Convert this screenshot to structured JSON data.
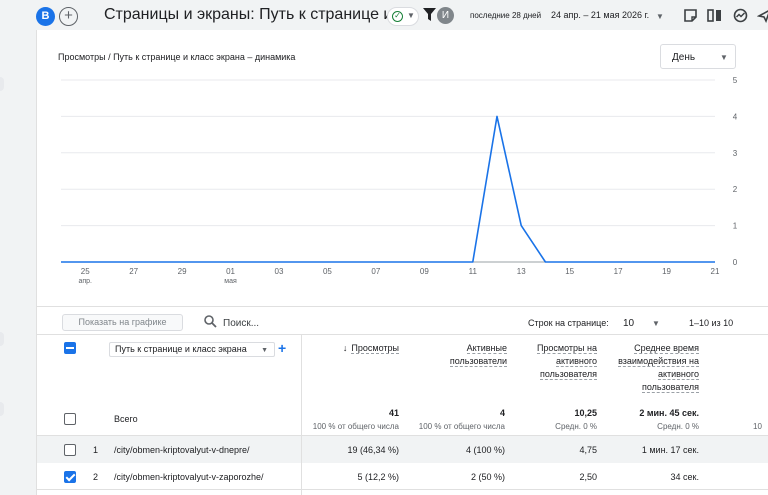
{
  "header": {
    "avatar_letter": "В",
    "add_label": "+",
    "title": "Страницы и экраны: Путь к странице и к...",
    "user_initial": "И",
    "daterange_label": "последние 28 дней",
    "daterange_value": "24 апр. – 21 мая 2026 г.",
    "icons": [
      "note-icon",
      "compare-icon",
      "insights-icon",
      "share-icon"
    ]
  },
  "chart": {
    "title": "Просмотры / Путь к странице и класс экрана – динамика",
    "granularity": "День"
  },
  "chart_data": {
    "type": "line",
    "x_ticks": [
      "25",
      "27",
      "29",
      "01",
      "03",
      "05",
      "07",
      "09",
      "11",
      "13",
      "15",
      "17",
      "19",
      "21"
    ],
    "x_subticks": {
      "25": "апр.",
      "01": "мая"
    },
    "x": [
      "24 апр.",
      "25 апр.",
      "26 апр.",
      "27 апр.",
      "28 апр.",
      "29 апр.",
      "30 апр.",
      "01 мая",
      "02 мая",
      "03 мая",
      "04 мая",
      "05 мая",
      "06 мая",
      "07 мая",
      "08 мая",
      "09 мая",
      "10 мая",
      "11 мая",
      "12 мая",
      "13 мая",
      "14 мая",
      "15 мая",
      "16 мая",
      "17 мая",
      "18 мая",
      "19 мая",
      "20 мая",
      "21 мая"
    ],
    "series": [
      {
        "values": [
          0,
          0,
          0,
          0,
          0,
          0,
          0,
          0,
          0,
          0,
          0,
          0,
          0,
          0,
          0,
          0,
          0,
          0,
          4,
          1,
          0,
          0,
          0,
          0,
          0,
          0,
          0,
          0
        ],
        "color": "#1a73e8"
      }
    ],
    "y_ticks": [
      "0",
      "1",
      "2",
      "3",
      "4",
      "5"
    ],
    "ylim": [
      0,
      5
    ],
    "grid": true
  },
  "table": {
    "plot_button": "Показать на графике",
    "search_placeholder": "Поиск...",
    "rows_per_page_label": "Строк на странице:",
    "rows_per_page": "10",
    "range": "1–10 из 10",
    "dimension": "Путь к странице и класс экрана",
    "columns": [
      {
        "label": "Просмотры",
        "sorted": true
      },
      {
        "label": "Активные пользователи"
      },
      {
        "label": "Просмотры на активного пользователя"
      },
      {
        "label": "Среднее время взаимодействия на активного пользователя"
      }
    ],
    "totals": {
      "label": "Всего",
      "values": [
        "41",
        "4",
        "10,25",
        "2 мин. 45 сек."
      ],
      "subs": [
        "100 % от общего числа",
        "100 % от общего числа",
        "Средн. 0 %",
        "Средн. 0 %"
      ],
      "edge": "10"
    },
    "rows": [
      {
        "idx": "1",
        "path": "/city/obmen-kriptovalyut-v-dnepre/",
        "checked": false,
        "values": [
          "19 (46,34 %)",
          "4 (100 %)",
          "4,75",
          "1 мин. 17 сек."
        ]
      },
      {
        "idx": "2",
        "path": "/city/obmen-kriptovalyut-v-zaporozhe/",
        "checked": true,
        "values": [
          "5 (12,2 %)",
          "2 (50 %)",
          "2,50",
          "34 сек."
        ]
      }
    ]
  }
}
